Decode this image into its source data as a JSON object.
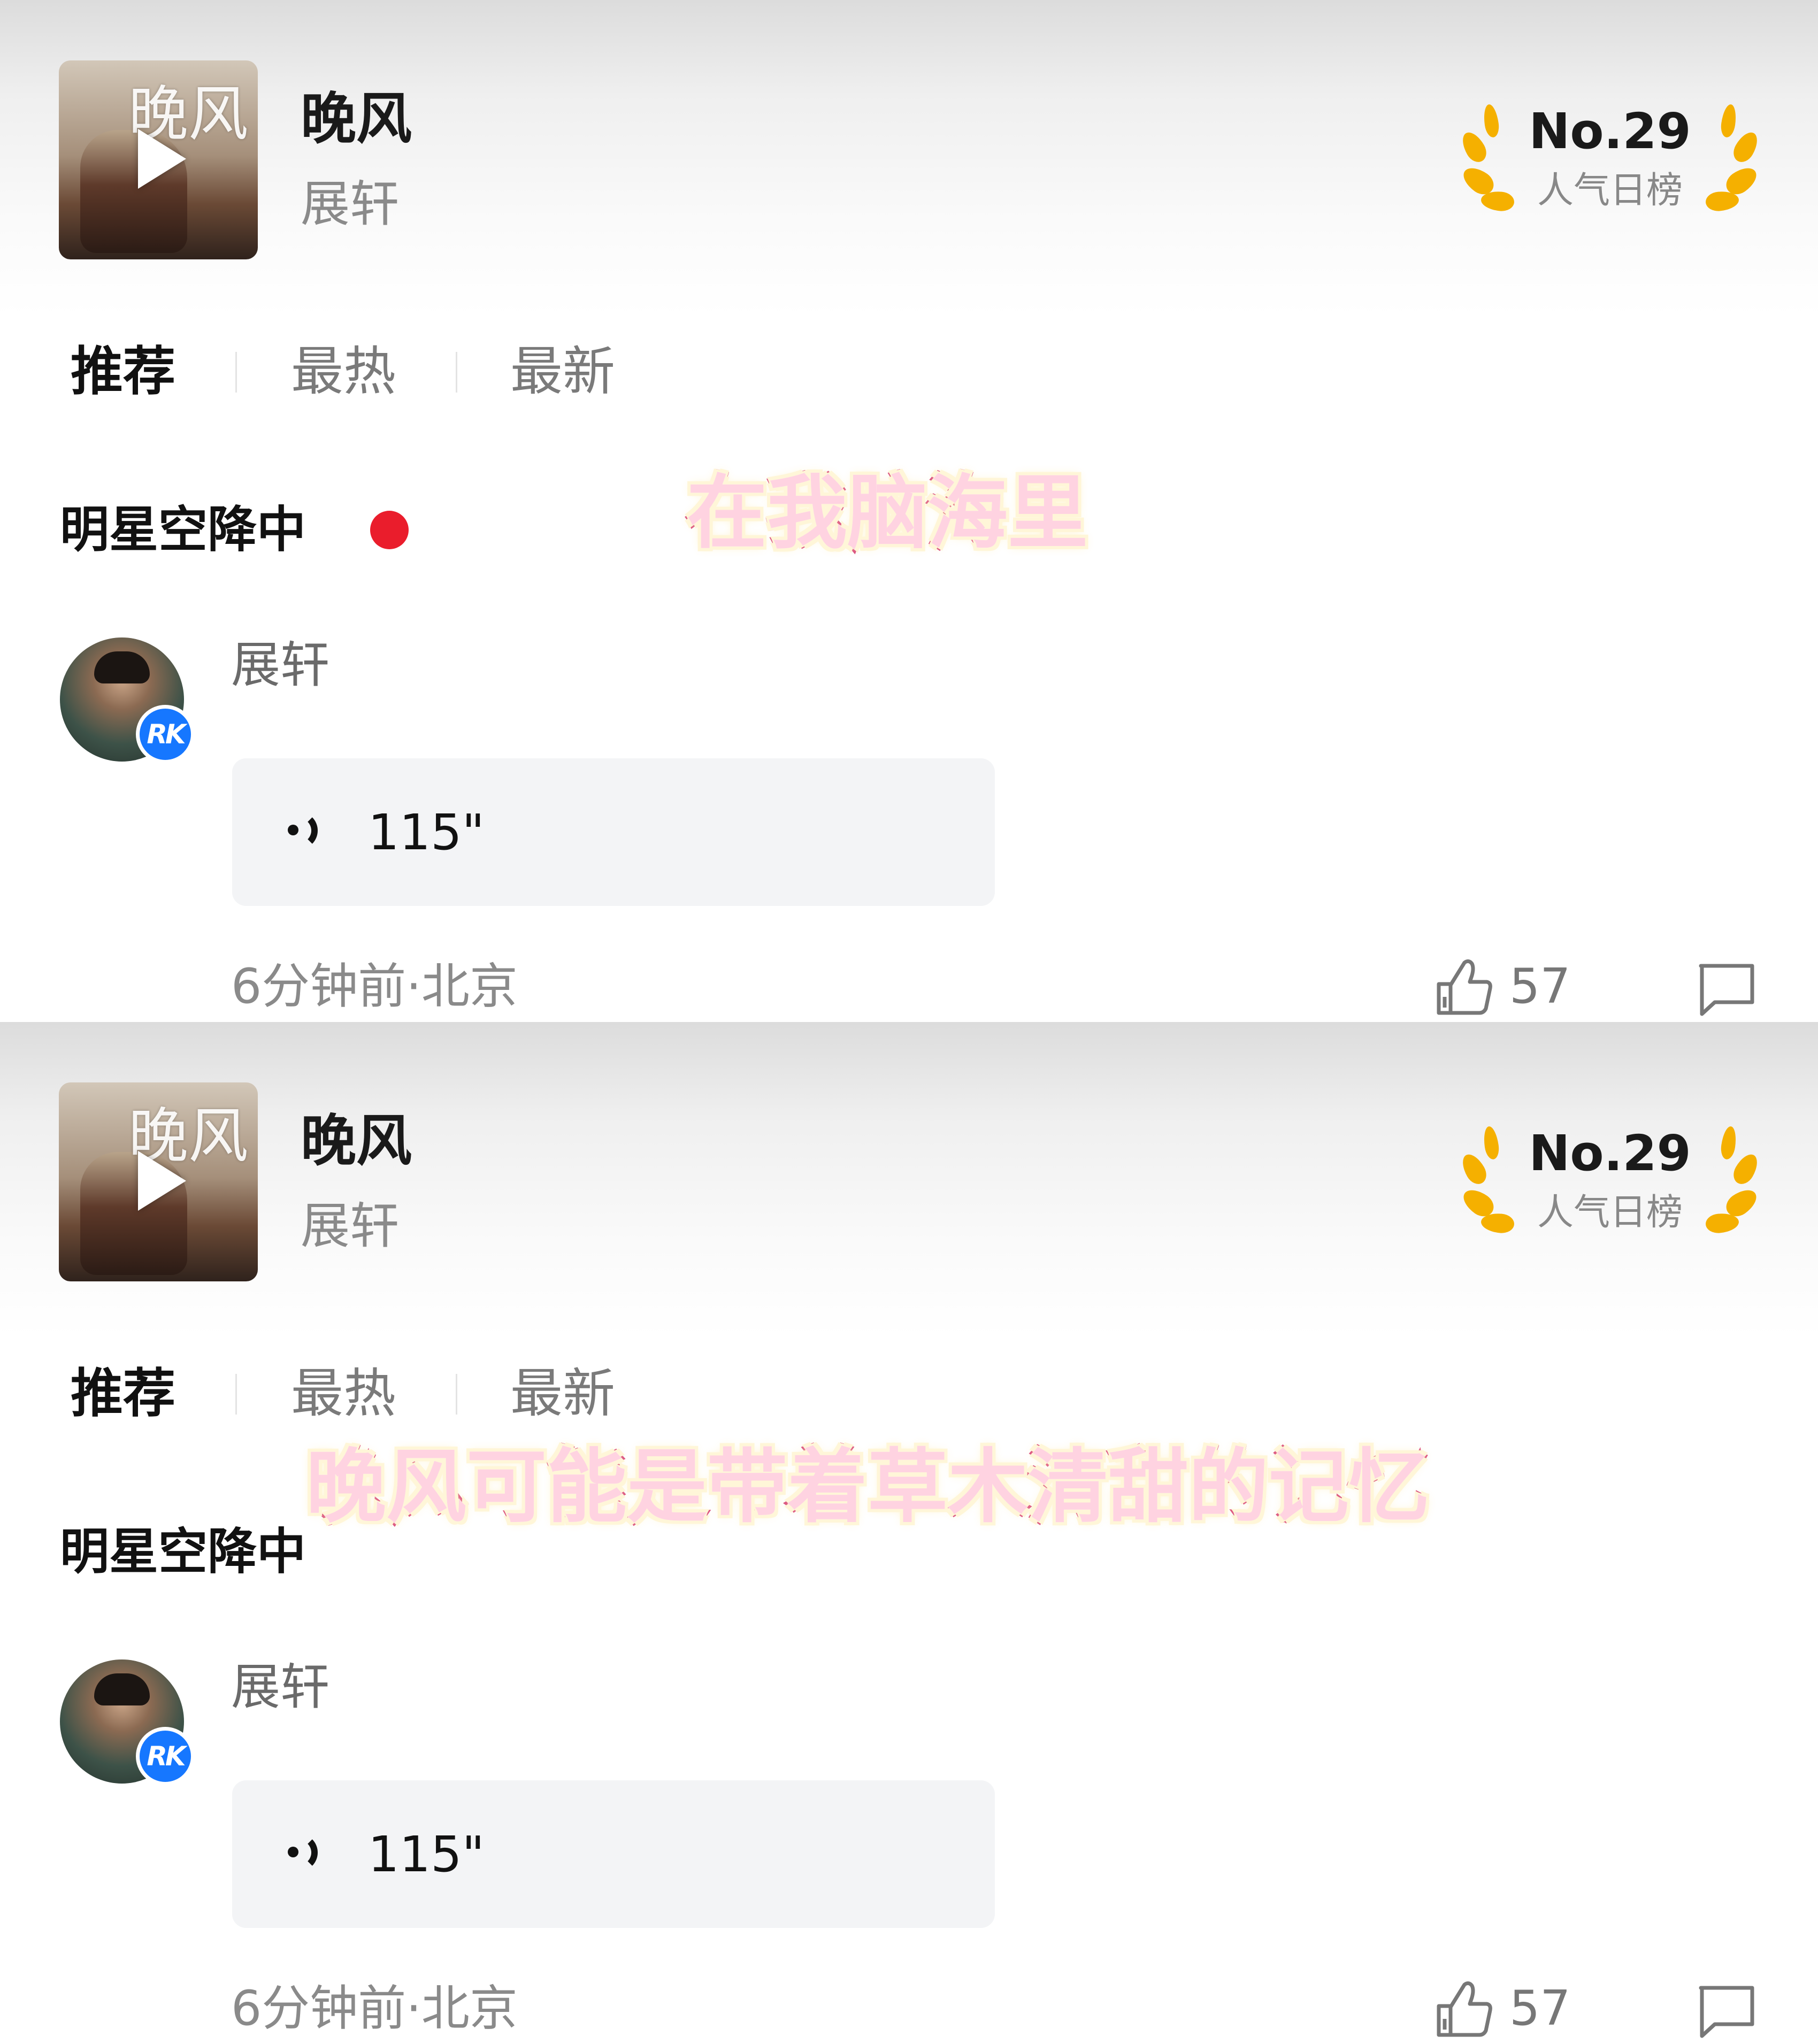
{
  "song": {
    "title": "晚风",
    "artist": "展轩",
    "cover_text": "晚风"
  },
  "rank": {
    "number": "No.29",
    "label": "人气日榜"
  },
  "tabs": [
    "推荐",
    "最热",
    "最新"
  ],
  "section": {
    "title": "明星空降中"
  },
  "post": {
    "user": "展轩",
    "badge": "RK",
    "voice_duration": "115\"",
    "time_location": "6分钟前·北京",
    "likes": "57"
  },
  "subtitles": [
    "在我脑海里",
    "晚风可能是带着草木清甜的记忆"
  ],
  "colors": {
    "accent_gold": "#f5b000",
    "live_red": "#ea1d2c",
    "badge_blue": "#1677ff"
  }
}
